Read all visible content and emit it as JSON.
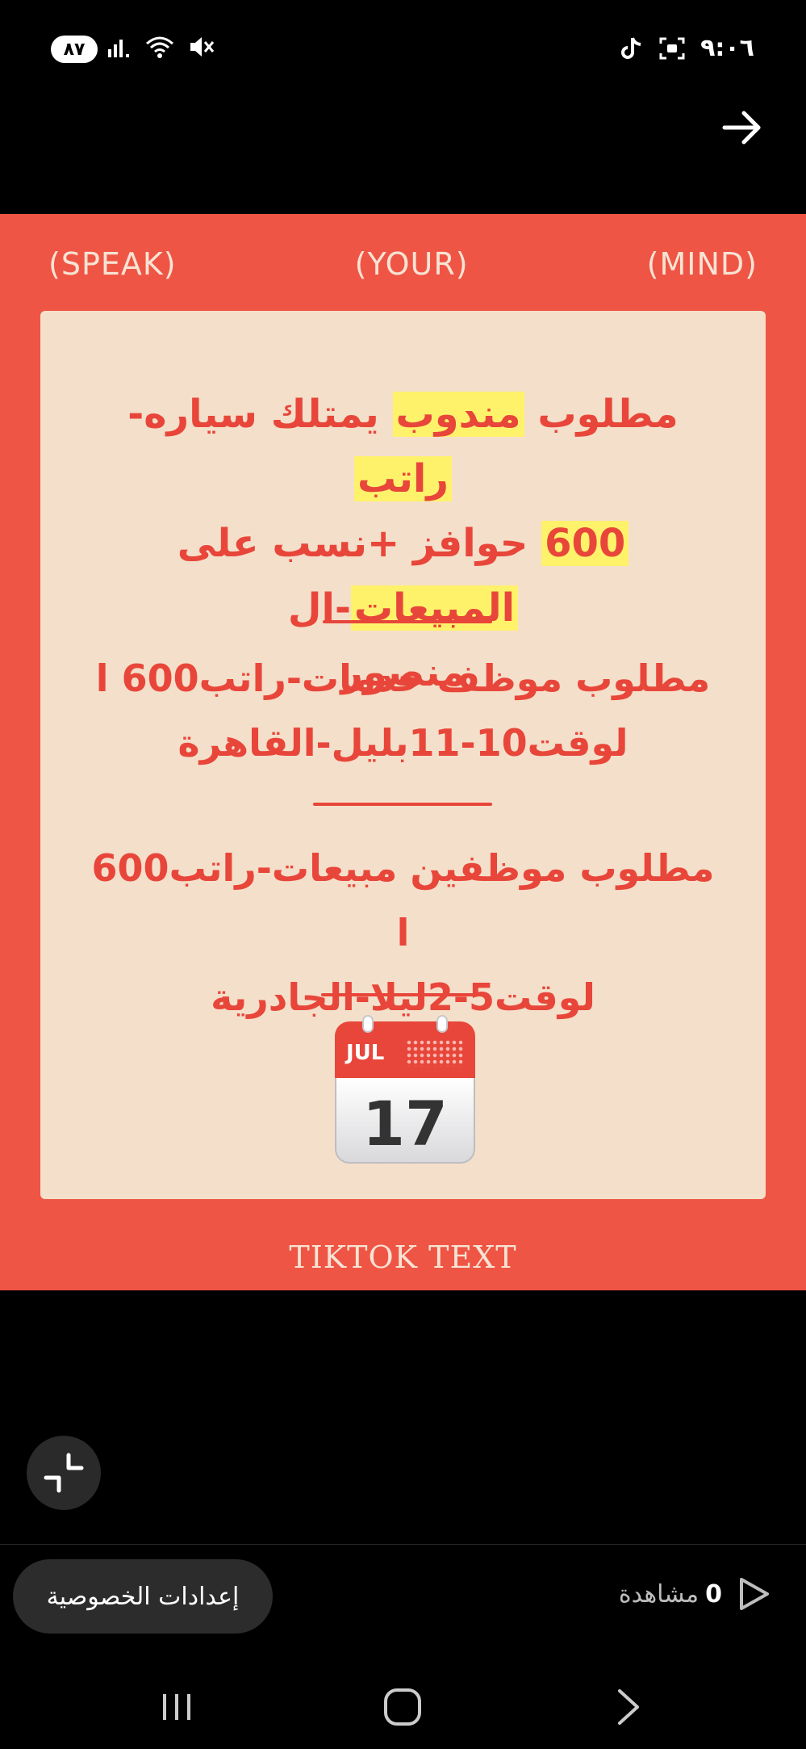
{
  "status_bar": {
    "battery": "٨٧",
    "time": "٩:٠٦"
  },
  "video": {
    "topline": [
      "(SPEAK)",
      "(YOUR)",
      "(MIND)"
    ],
    "post1": {
      "line1_a": "مطلوب ",
      "line1_hl1": "مندوب",
      "line1_b": " يمتلك سياره-",
      "line1_hl2": "راتب",
      "line2_hl": "600",
      "line2_a": " حوافز +نسب على ",
      "line2_hl2": "المبيعات",
      "line2_b": "-ال",
      "line3": "منصور"
    },
    "post2": {
      "line1": "مطلوب موظف خدمات-راتب600 ا",
      "line2": "لوقت10-11بليل-القاهرة"
    },
    "post3": {
      "line1": "مطلوب موظفين مبيعات-راتب600 ا",
      "line2": "لوقت5-2ليلا-الجادرية"
    },
    "calendar": {
      "month": "JUL",
      "day": "17"
    },
    "watermark": "TIKTOK TEXT"
  },
  "bottom": {
    "privacy_label": "إعدادات الخصوصية",
    "views_count": "0",
    "views_label": "مشاهدة"
  },
  "colors": {
    "accent_red": "#ef5545",
    "card_bg": "#f4dfca",
    "text_red": "#e8463a",
    "highlight": "#fff26b"
  }
}
